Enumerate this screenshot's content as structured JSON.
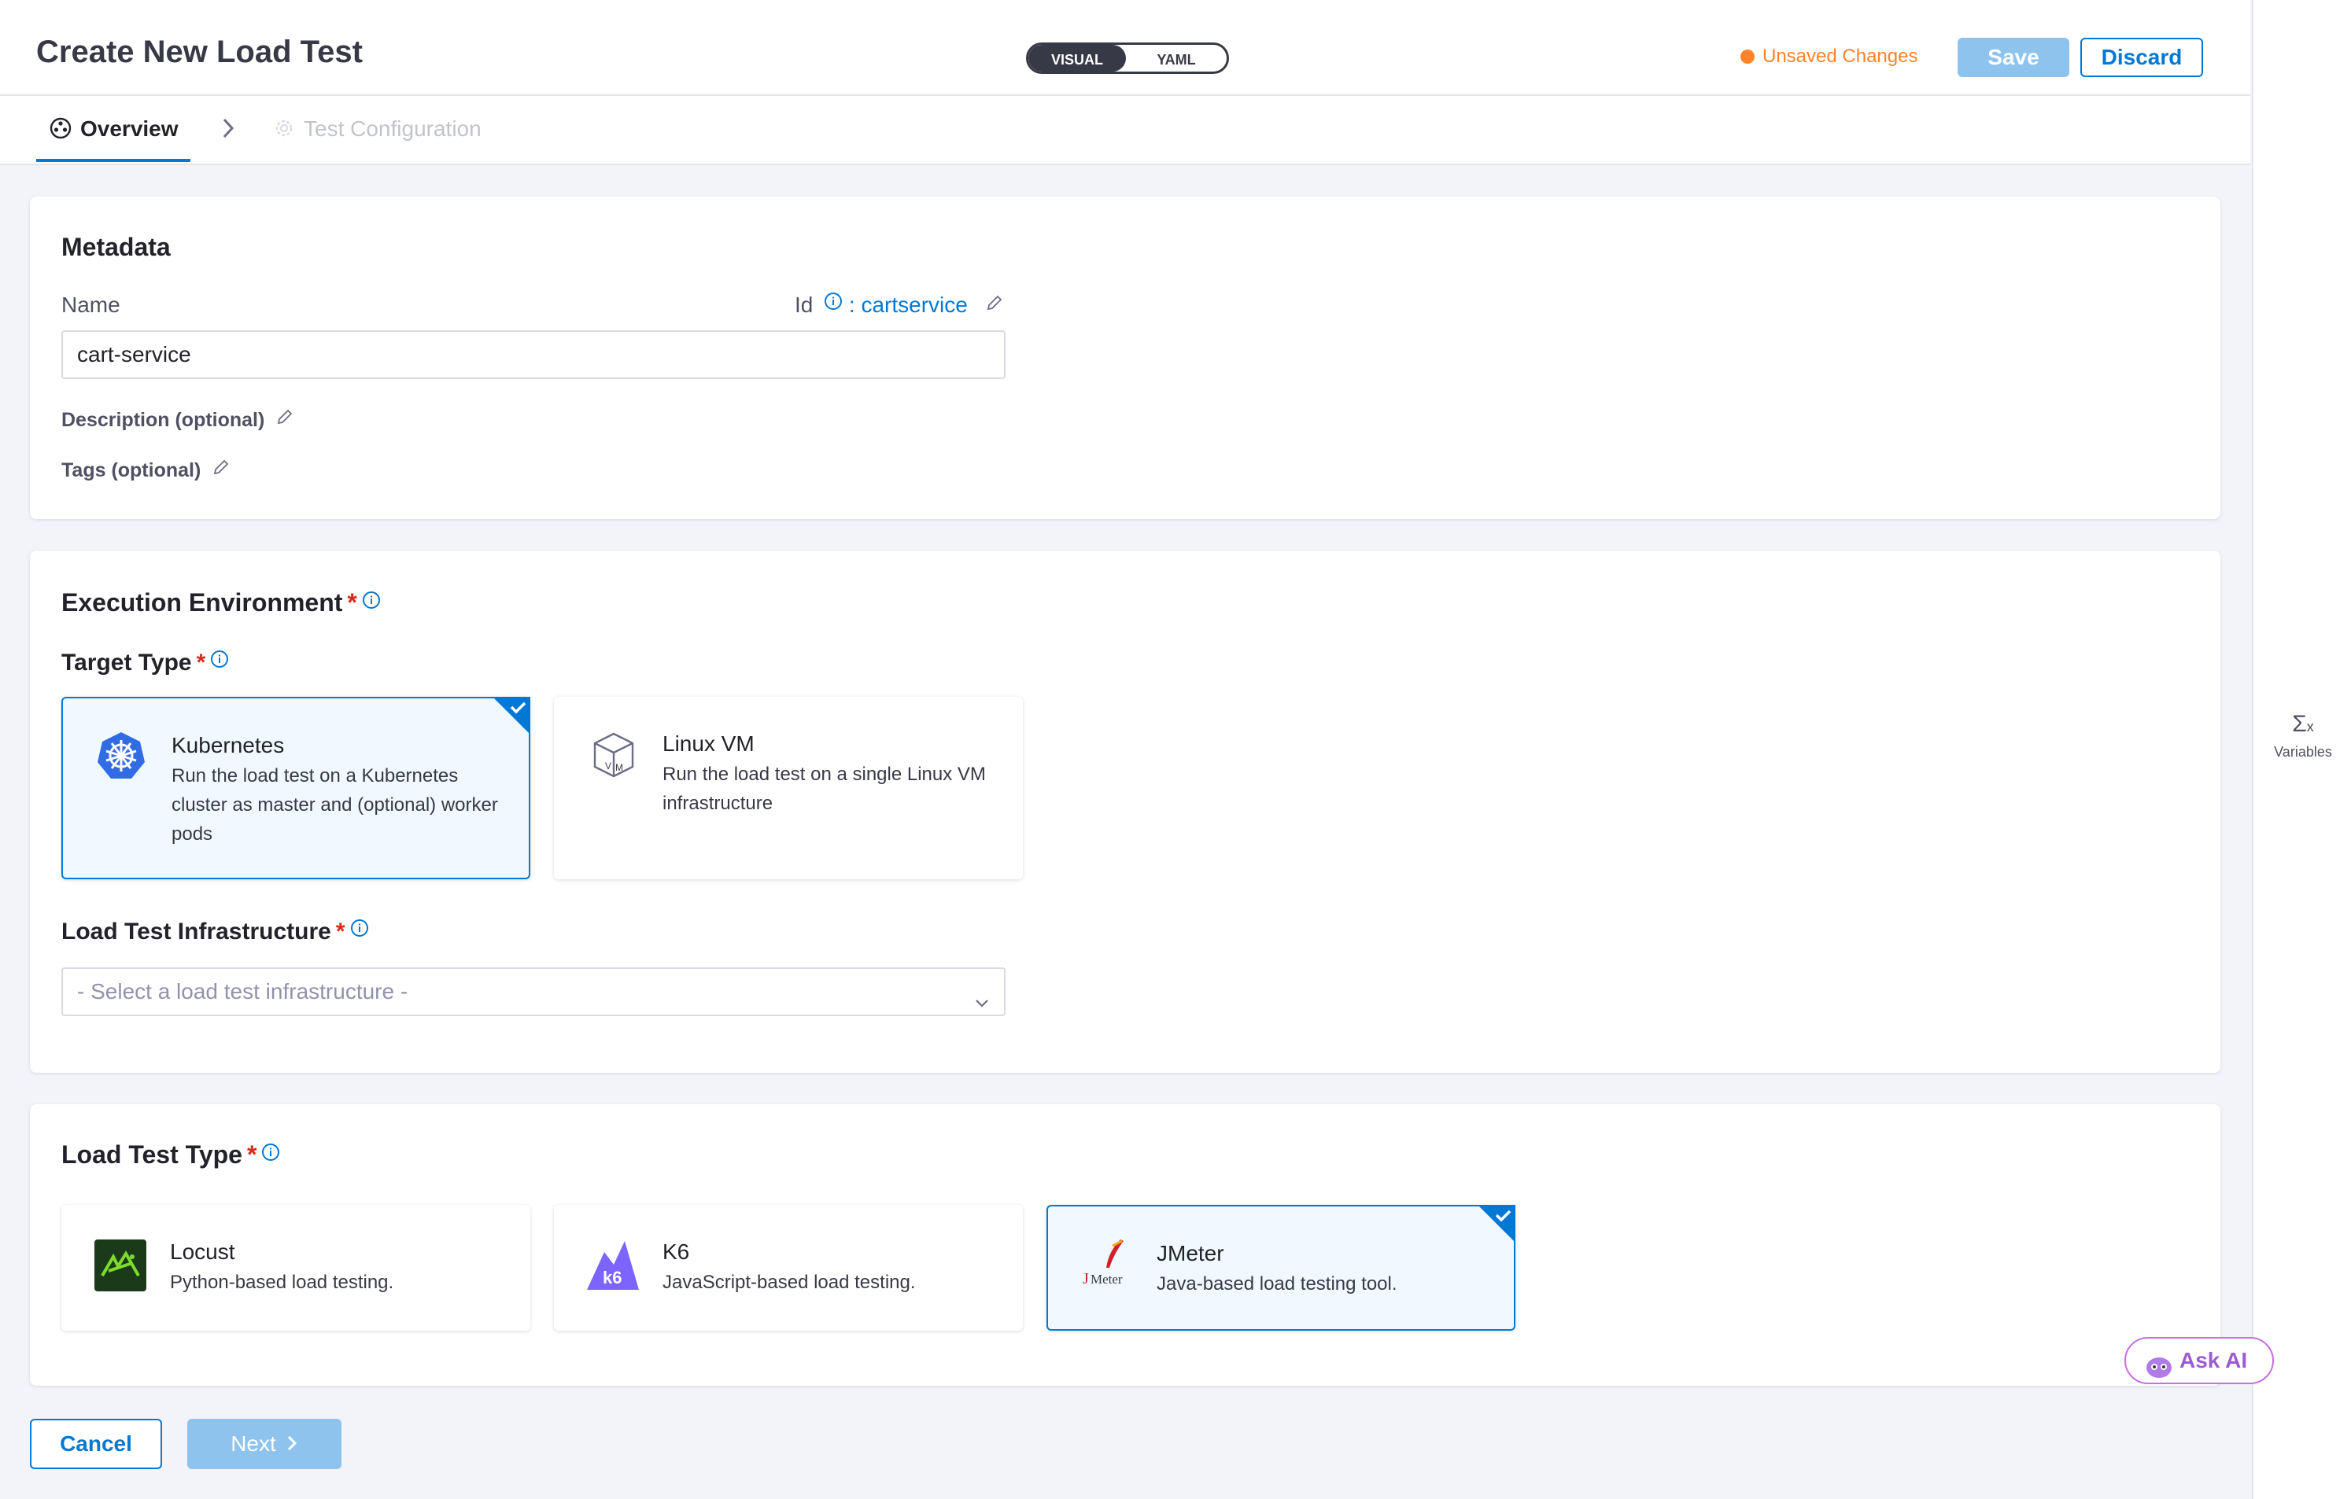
{
  "header": {
    "title": "Create New Load Test",
    "mode_visual": "VISUAL",
    "mode_yaml": "YAML",
    "unsaved": "Unsaved Changes",
    "save": "Save",
    "discard": "Discard"
  },
  "tabs": {
    "overview": "Overview",
    "test_configuration": "Test Configuration"
  },
  "rail": {
    "variables": "Variables"
  },
  "metadata": {
    "title": "Metadata",
    "name_label": "Name",
    "name_value": "cart-service",
    "id_label": "Id",
    "id_value": ": cartservice",
    "description": "Description (optional)",
    "tags": "Tags (optional)"
  },
  "environment": {
    "title": "Execution Environment",
    "required_mark": "*",
    "target_type_label": "Target Type",
    "targets": [
      {
        "title": "Kubernetes",
        "description": "Run the load test on a Kubernetes cluster as master and (optional) worker pods",
        "selected": true,
        "icon": "kubernetes-icon"
      },
      {
        "title": "Linux VM",
        "description": "Run the load test on a single Linux VM infrastructure",
        "selected": false,
        "icon": "linux-vm-icon"
      }
    ],
    "infrastructure_label": "Load Test Infrastructure",
    "infrastructure_placeholder": "- Select a load test infrastructure -"
  },
  "load_test_type": {
    "title": "Load Test Type",
    "types": [
      {
        "title": "Locust",
        "description": "Python-based load testing.",
        "selected": false,
        "icon": "locust-icon"
      },
      {
        "title": "K6",
        "description": "JavaScript-based load testing.",
        "selected": false,
        "icon": "k6-icon"
      },
      {
        "title": "JMeter",
        "description": "Java-based load testing tool.",
        "selected": true,
        "icon": "jmeter-icon"
      }
    ]
  },
  "footer": {
    "cancel": "Cancel",
    "next": "Next"
  },
  "ask_ai": "Ask AI",
  "colors": {
    "accent": "#0278d5",
    "selected_bg": "#eff9ff",
    "required": "#da291d",
    "unsaved": "#ff832b",
    "disabled_button": "#8ec3ee"
  }
}
